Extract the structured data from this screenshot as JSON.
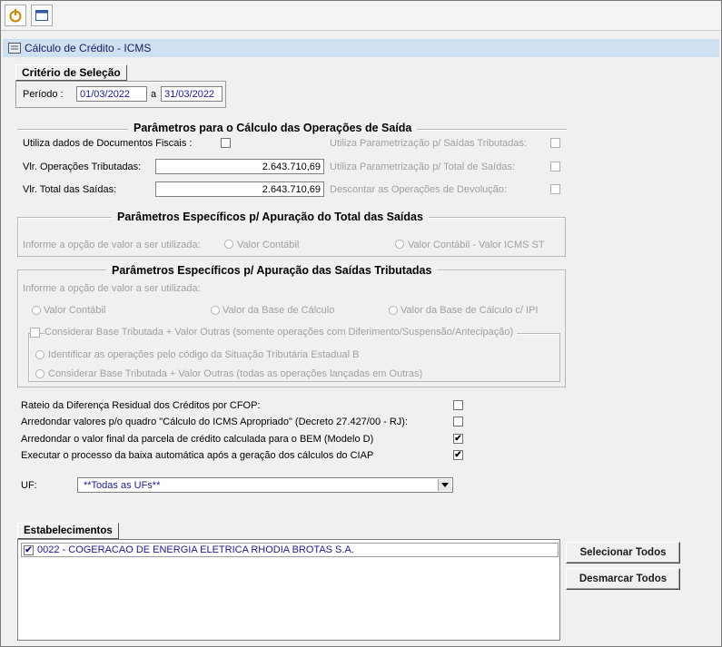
{
  "window": {
    "title": "Cálculo de Crédito - ICMS"
  },
  "toolbar": {
    "icons": [
      "power-icon",
      "window-icon"
    ]
  },
  "selection": {
    "group_label": "Critério de Seleção",
    "period_label": "Período :",
    "period_start": "01/03/2022",
    "period_sep": "a",
    "period_end": "31/03/2022"
  },
  "saida": {
    "header": "Parâmetros para o Cálculo das Operações de Saída",
    "utiliza_docs_label": "Utiliza dados de Documentos Fiscais :",
    "utiliza_docs_checked": false,
    "vlr_oper_label": "Vlr. Operações Tributadas:",
    "vlr_oper_value": "2.643.710,69",
    "vlr_total_label": "Vlr. Total das Saídas:",
    "vlr_total_value": "2.643.710,69",
    "right_options": [
      {
        "label": "Utiliza Parametrização p/ Saídas Tributadas:",
        "checked": false
      },
      {
        "label": "Utiliza Parametrização p/ Total de Saídas:",
        "checked": false
      },
      {
        "label": "Descontar as Operações de Devolução:",
        "checked": false
      }
    ]
  },
  "total_saidas": {
    "header": "Parâmetros Específicos p/ Apuração do Total das Saídas",
    "prompt": "Informe a opção de valor a ser utilizada:",
    "opt1": "Valor Contábil",
    "opt2": "Valor Contábil - Valor ICMS ST"
  },
  "saidas_trib": {
    "header": "Parâmetros Específicos p/ Apuração das Saídas Tributadas",
    "prompt": "Informe a opção de valor a ser utilizada:",
    "opt1": "Valor Contábil",
    "opt2": "Valor da Base de Cálculo",
    "opt3": "Valor da Base de Cálculo c/ IPI",
    "considerar_label": "Considerar Base Tributada + Valor Outras (somente operações com Diferimento/Suspensão/Antecipação)",
    "sub1": "Identificar as operações pelo código da Situação Tributária Estadual B",
    "sub2": "Considerar Base Tributada + Valor Outras (todas as operações lançadas em Outras)"
  },
  "options": [
    {
      "label": "Rateio da Diferença Residual dos Créditos por CFOP:",
      "checked": false
    },
    {
      "label": "Arredondar valores p/o quadro \"Cálculo do ICMS Apropriado\" (Decreto 27.427/00 - RJ):",
      "checked": false
    },
    {
      "label": "Arredondar o valor final da parcela de crédito calculada para o BEM (Modelo D)",
      "checked": true
    },
    {
      "label": "Executar o processo da baixa automática após a geração dos cálculos do CIAP",
      "checked": true
    }
  ],
  "uf": {
    "label": "UF:",
    "value": "**Todas as UFs**"
  },
  "estab": {
    "group_label": "Estabelecimentos",
    "items": [
      {
        "label": "0022 - COGERACAO DE ENERGIA ELETRICA RHODIA BROTAS S.A.",
        "checked": true
      }
    ],
    "select_all": "Selecionar Todos",
    "deselect_all": "Desmarcar Todos"
  },
  "checkmark": "✔"
}
